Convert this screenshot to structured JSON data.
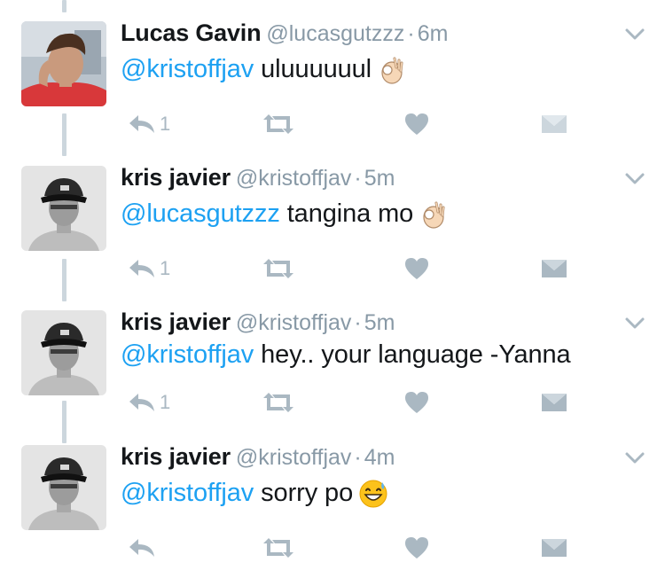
{
  "colors": {
    "mention": "#1da1f2",
    "action_icon": "#aab8c2",
    "handle": "#8899a6",
    "thread_line": "#ccd6dd"
  },
  "tweets": [
    {
      "name": "Lucas Gavin",
      "handle": "@lucasgutzzz",
      "separator": "·",
      "time": "6m",
      "mention": "@kristoffjav",
      "body": " uluuuuuul",
      "emoji": "ok-hand-emoji",
      "reply_count": "1"
    },
    {
      "name": "kris javier",
      "handle": "@kristoffjav",
      "separator": "·",
      "time": "5m",
      "mention": "@lucasgutzzz",
      "body": " tangina mo",
      "emoji": "ok-hand-emoji",
      "reply_count": "1"
    },
    {
      "name": "kris javier",
      "handle": "@kristoffjav",
      "separator": "·",
      "time": "5m",
      "mention": "@kristoffjav",
      "body": " hey.. your language -Yanna",
      "emoji": "",
      "reply_count": "1"
    },
    {
      "name": "kris javier",
      "handle": "@kristoffjav",
      "separator": "·",
      "time": "4m",
      "mention": "@kristoffjav",
      "body": " sorry po",
      "emoji": "grinning-sweat-emoji",
      "reply_count": ""
    }
  ]
}
